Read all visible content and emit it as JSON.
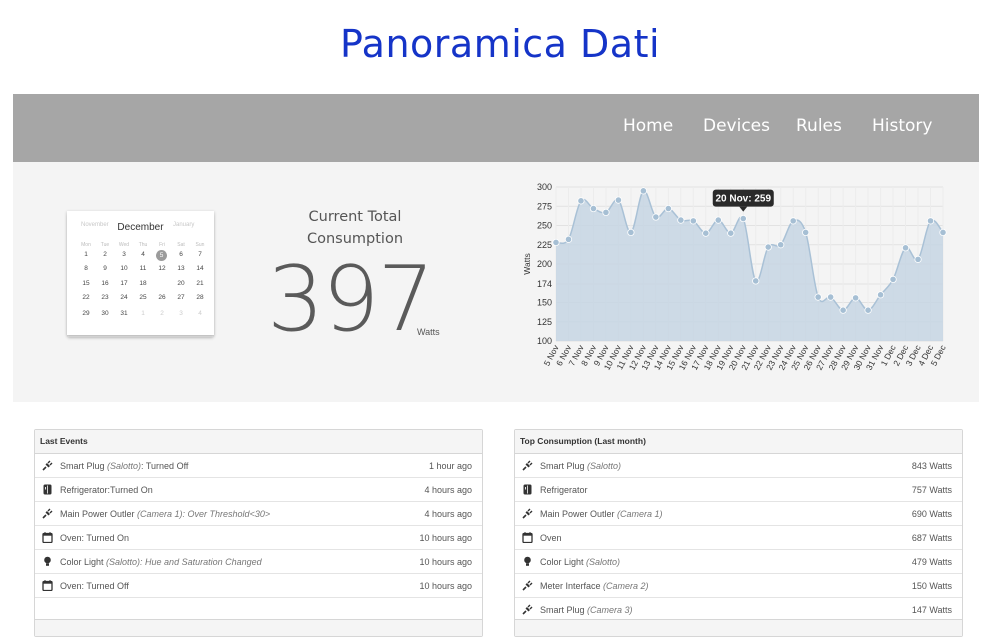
{
  "page": {
    "title": "Panoramica Dati"
  },
  "nav": {
    "items": [
      "Home",
      "Devices",
      "Rules",
      "History"
    ]
  },
  "calendar": {
    "prev_month": "November",
    "month": "December",
    "next_month": "January",
    "weekdays": [
      "Mon",
      "Tue",
      "Wed",
      "Thu",
      "Fri",
      "Sat",
      "Sun"
    ],
    "weeks": [
      [
        "1",
        "2",
        "3",
        "4",
        "5",
        "6",
        "7"
      ],
      [
        "8",
        "9",
        "10",
        "11",
        "12",
        "13",
        "14"
      ],
      [
        "15",
        "16",
        "17",
        "18",
        "",
        "20",
        "21"
      ],
      [
        "22",
        "23",
        "24",
        "25",
        "26",
        "27",
        "28"
      ],
      [
        "29",
        "30",
        "31",
        "1",
        "2",
        "3",
        "4"
      ]
    ],
    "today": "5",
    "trailing_from": 3
  },
  "consumption": {
    "title": "Current Total Consumption",
    "value": "397",
    "unit": "Watts"
  },
  "chart_data": {
    "type": "area",
    "ylabel": "Watts",
    "xlabel": "",
    "ylim": [
      100,
      300
    ],
    "yticks": [
      100,
      125,
      150,
      174,
      200,
      225,
      250,
      275,
      300
    ],
    "categories": [
      "5 Nov",
      "6 Nov",
      "7 Nov",
      "8 Nov",
      "9 Nov",
      "10 Nov",
      "11 Nov",
      "12 Nov",
      "13 Nov",
      "14 Nov",
      "15 Nov",
      "16 Nov",
      "17 Nov",
      "18 Nov",
      "19 Nov",
      "20 Nov",
      "21 Nov",
      "22 Nov",
      "23 Nov",
      "24 Nov",
      "25 Nov",
      "26 Nov",
      "27 Nov",
      "28 Nov",
      "29 Nov",
      "30 Nov",
      "31 Nov",
      "1 Dec",
      "2 Dec",
      "3 Dec",
      "4 Dec",
      "5 Dec"
    ],
    "series": [
      {
        "values": [
          228,
          232,
          282,
          272,
          267,
          283,
          241,
          295,
          261,
          272,
          257,
          256,
          240,
          257,
          240,
          259,
          178,
          222,
          225,
          256,
          241,
          157,
          157,
          140,
          156,
          140,
          160,
          180,
          221,
          206,
          256,
          241
        ]
      }
    ],
    "tooltip": {
      "index": 15,
      "text": "20 Nov: 259"
    },
    "grid": true,
    "colors": {
      "fill": "#c5d5e3",
      "line": "#a9c1d6",
      "point": "#a6bfd4"
    }
  },
  "events": {
    "title": "Last Events",
    "rows": [
      {
        "icon": "plug-icon",
        "label": "Smart Plug ",
        "location": "(Salotto)",
        "detail": ": Turned Off",
        "time": "1 hour ago"
      },
      {
        "icon": "fridge-icon",
        "label": "Refrigerator:Turned On",
        "location": "",
        "detail": "",
        "time": "4 hours ago"
      },
      {
        "icon": "plug-icon",
        "label": "Main Power Outler ",
        "location": "(Camera 1): Over Threshold<30>",
        "detail": "",
        "time": "4 hours ago"
      },
      {
        "icon": "oven-icon",
        "label": "Oven: Turned On",
        "location": "",
        "detail": "",
        "time": "10 hours ago"
      },
      {
        "icon": "bulb-icon",
        "label": "Color Light ",
        "location": "(Salotto): Hue and Saturation Changed",
        "detail": "",
        "time": "10 hours ago"
      },
      {
        "icon": "oven-icon",
        "label": "Oven: Turned Off",
        "location": "",
        "detail": "",
        "time": "10 hours ago"
      }
    ]
  },
  "top": {
    "title": "Top Consumption (Last month)",
    "rows": [
      {
        "icon": "plug-icon",
        "label": "Smart Plug ",
        "location": "(Salotto)",
        "value": "843 Watts"
      },
      {
        "icon": "fridge-icon",
        "label": "Refrigerator",
        "location": "",
        "value": "757 Watts"
      },
      {
        "icon": "plug-icon",
        "label": "Main Power Outler ",
        "location": "(Camera 1)",
        "value": "690 Watts"
      },
      {
        "icon": "oven-icon",
        "label": "Oven",
        "location": "",
        "value": "687 Watts"
      },
      {
        "icon": "bulb-icon",
        "label": "Color Light ",
        "location": "(Salotto)",
        "value": "479 Watts"
      },
      {
        "icon": "plug-icon",
        "label": "Meter Interface ",
        "location": "(Camera 2)",
        "value": "150 Watts"
      },
      {
        "icon": "plug-icon",
        "label": "Smart Plug ",
        "location": "(Camera 3)",
        "value": "147 Watts"
      }
    ]
  }
}
